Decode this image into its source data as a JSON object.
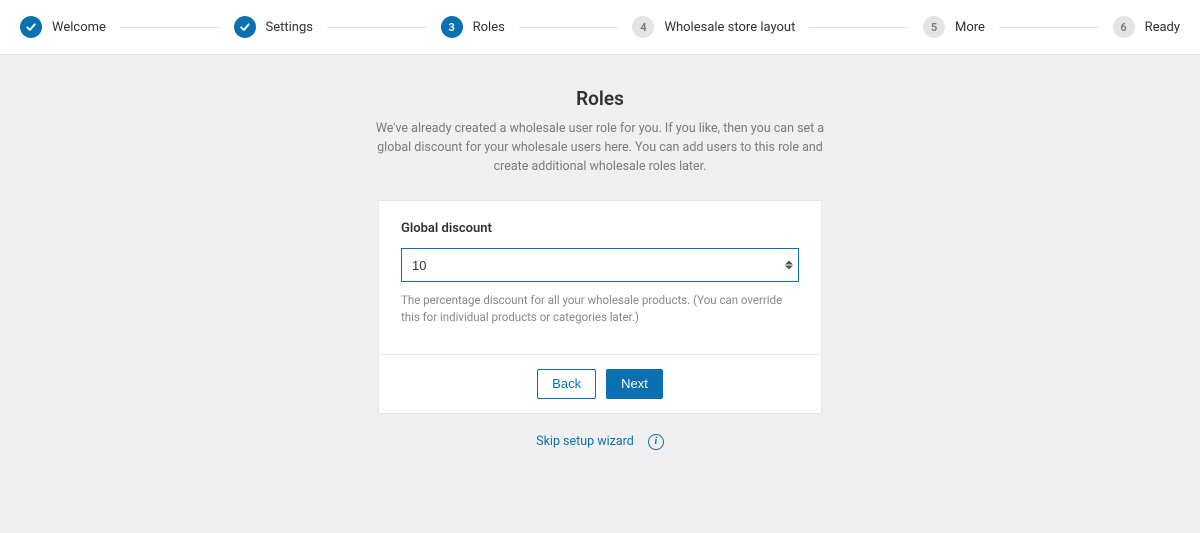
{
  "steps": [
    {
      "label": "Welcome",
      "num": "✓",
      "state": "done"
    },
    {
      "label": "Settings",
      "num": "✓",
      "state": "done"
    },
    {
      "label": "Roles",
      "num": "3",
      "state": "active"
    },
    {
      "label": "Wholesale store layout",
      "num": "4",
      "state": "pending"
    },
    {
      "label": "More",
      "num": "5",
      "state": "pending"
    },
    {
      "label": "Ready",
      "num": "6",
      "state": "pending"
    }
  ],
  "page": {
    "title": "Roles",
    "description": "We've already created a wholesale user role for you. If you like, then you can set a global discount for your wholesale users here. You can add users to this role and create additional wholesale roles later."
  },
  "form": {
    "global_discount_label": "Global discount",
    "global_discount_value": "10",
    "global_discount_help": "The percentage discount for all your wholesale products. (You can override this for individual products or categories later.)"
  },
  "buttons": {
    "back": "Back",
    "next": "Next"
  },
  "footer": {
    "skip": "Skip setup wizard"
  }
}
